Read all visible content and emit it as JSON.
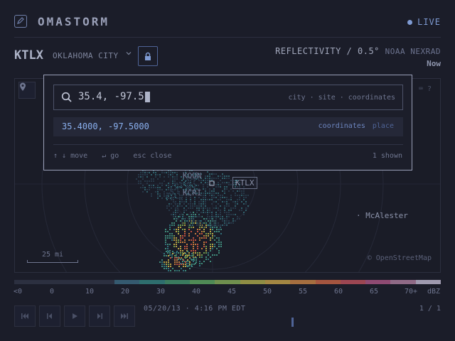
{
  "header": {
    "brand": "OMASTORM",
    "live_label": "LIVE",
    "brand_icon": "pencil-square-icon"
  },
  "station_bar": {
    "station_id": "KTLX",
    "city": "OKLAHOMA CITY",
    "chevron_icon": "chevron-down-icon",
    "lock_icon": "lock-icon",
    "product": "REFLECTIVITY / 0.5°",
    "source": "NOAA NEXRAD",
    "time_label": "Now"
  },
  "map": {
    "labels": {
      "mcalester": "· McAlester",
      "koun": "KOUN",
      "kcri": "KCRI",
      "ktlx": "KTLX"
    },
    "scale_label": "25 mi",
    "attribution": "© OpenStreetMap",
    "pin_icon": "map-pin-icon",
    "keyboard_icon": "keyboard-icon",
    "help_label": "?"
  },
  "colorbar": {
    "colors": [
      "#2c3040",
      "#2c3040",
      "#2c3040",
      "#2c3040",
      "#355a70",
      "#2e6e6e",
      "#3a7a5e",
      "#4f8a55",
      "#6f8f4e",
      "#8f8d44",
      "#a28642",
      "#a56e3f",
      "#a4553f",
      "#9c4652",
      "#8e4a72",
      "#8f6a86",
      "#9f9aaf"
    ],
    "ticks": [
      "<0",
      "0",
      "10",
      "20",
      "30",
      "40",
      "45",
      "50",
      "55",
      "60",
      "65",
      "70+",
      "dBZ"
    ]
  },
  "playback": {
    "buttons": [
      "skip-back-icon",
      "step-back-icon",
      "play-icon",
      "step-forward-icon",
      "skip-forward-icon"
    ],
    "timestamp": "05/20/13 · 4:16 PM EDT",
    "frame_counter": "1 / 1"
  },
  "palette": {
    "query": "35.4, -97.5",
    "hint": "city · site · coordinates",
    "result_coords": "35.4000, -97.5000",
    "result_tag_primary": "coordinates",
    "result_tag_secondary": "place",
    "footer_move": "↑ ↓ move",
    "footer_go": "↵ go",
    "footer_close": "esc close",
    "count": "1 shown"
  }
}
